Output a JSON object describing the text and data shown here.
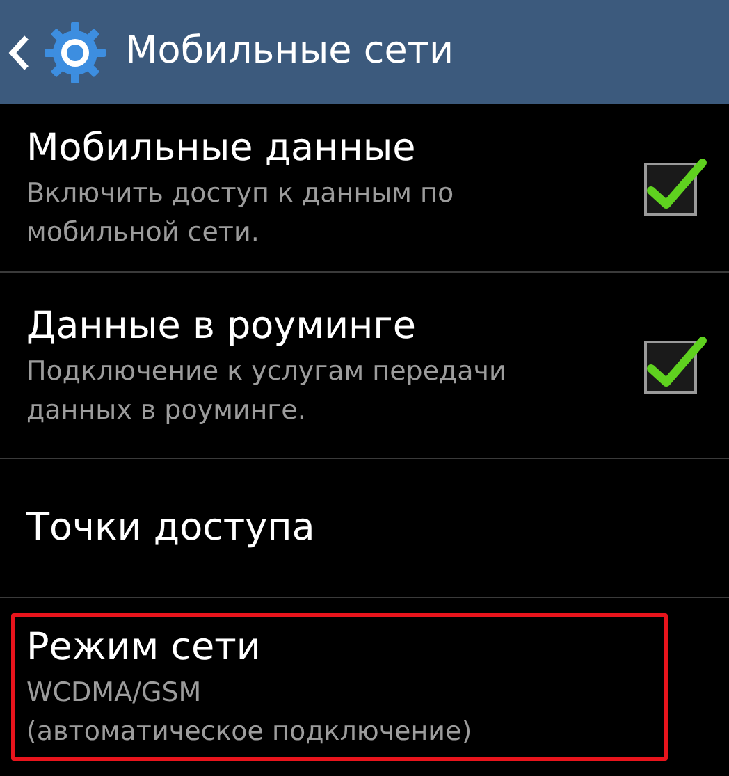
{
  "header": {
    "title": "Мобильные сети"
  },
  "items": [
    {
      "kind": "checkbox",
      "title": "Мобильные данные",
      "summary": [
        "Включить доступ к данным по",
        "мобильной сети."
      ],
      "checked": true,
      "highlighted": false
    },
    {
      "kind": "checkbox",
      "title": "Данные в роуминге",
      "summary": [
        "Подключение к услугам передачи",
        "данных в роуминге."
      ],
      "checked": true,
      "highlighted": false
    },
    {
      "kind": "plain",
      "title": "Точки доступа",
      "highlighted": false
    },
    {
      "kind": "plain",
      "title": "Режим сети",
      "summary": [
        "WCDMA/GSM",
        "(автоматическое подключение)"
      ],
      "highlighted": true
    }
  ]
}
